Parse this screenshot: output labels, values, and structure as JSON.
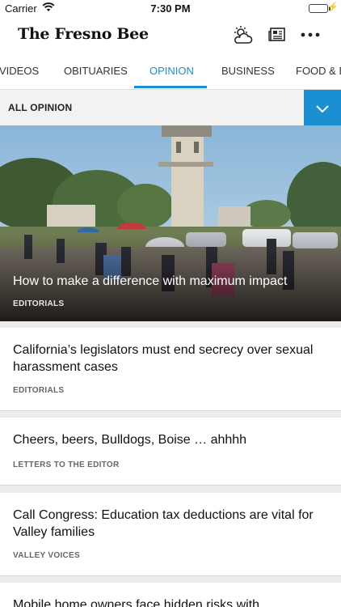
{
  "status": {
    "carrier": "Carrier",
    "time": "7:30 PM"
  },
  "header": {
    "logo": "The Fresno Bee"
  },
  "icons": {
    "weather": "weather-icon",
    "newspaper": "newspaper-icon",
    "more": "more-icon",
    "chevron": "chevron-down-icon",
    "wifi": "wifi-icon",
    "battery": "battery-icon"
  },
  "tabs": [
    {
      "label": "VIDEOS"
    },
    {
      "label": "OBITUARIES"
    },
    {
      "label": "OPINION"
    },
    {
      "label": "BUSINESS"
    },
    {
      "label": "FOOD & DRINK"
    }
  ],
  "active_tab_index": 2,
  "filter": {
    "label": "ALL OPINION"
  },
  "colors": {
    "accent": "#1a8fd1",
    "battery": "#2ec94d"
  },
  "hero": {
    "title": "How to make a difference with maximum impact",
    "category": "EDITORIALS"
  },
  "articles": [
    {
      "headline": "California’s legislators must end secrecy over sexual harassment cases",
      "category": "EDITORIALS"
    },
    {
      "headline": "Cheers, beers, Bulldogs, Boise … ahhhh",
      "category": "LETTERS TO THE EDITOR"
    },
    {
      "headline": "Call Congress: Education tax deductions are vital for Valley families",
      "category": "VALLEY VOICES"
    },
    {
      "headline": "Mobile home owners face hidden risks with"
    }
  ]
}
